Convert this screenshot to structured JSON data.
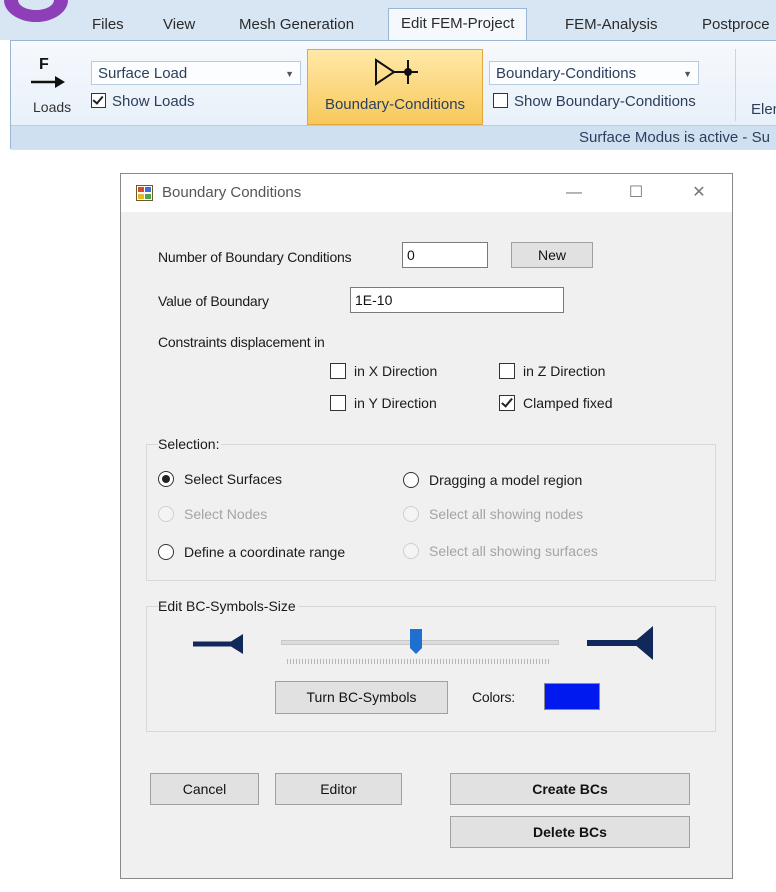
{
  "ribbon": {
    "tabs": [
      "Files",
      "View",
      "Mesh Generation",
      "Edit FEM-Project",
      "FEM-Analysis",
      "Postproce"
    ],
    "active_tab": "Edit FEM-Project",
    "loads_icon_letter": "F",
    "loads_label": "Loads",
    "load_type_combo": "Surface Load",
    "show_loads_label": "Show Loads",
    "show_loads_checked": true,
    "bc_button_label": "Boundary-Conditions",
    "bc_combo": "Boundary-Conditions",
    "show_bc_label": "Show Boundary-Conditions",
    "show_bc_checked": false,
    "element_label_partial": "Elen",
    "status_text": "Surface Modus is active - Su"
  },
  "dialog": {
    "title": "Boundary Conditions",
    "num_bc_label": "Number of Boundary Conditions",
    "num_bc_value": "0",
    "new_button": "New",
    "value_label": "Value of Boundary",
    "value_value": "1E-10",
    "constraints_label": "Constraints displacement in",
    "checks": {
      "x_dir": {
        "label": "in X Direction",
        "checked": false
      },
      "z_dir": {
        "label": "in Z Direction",
        "checked": false
      },
      "y_dir": {
        "label": "in Y Direction",
        "checked": false
      },
      "clamped": {
        "label": "Clamped fixed",
        "checked": true
      }
    },
    "selection": {
      "label": "Selection:",
      "options": {
        "surfaces": {
          "label": "Select Surfaces",
          "selected": true,
          "enabled": true
        },
        "dragging": {
          "label": "Dragging a model region",
          "selected": false,
          "enabled": true
        },
        "nodes": {
          "label": "Select Nodes",
          "selected": false,
          "enabled": false
        },
        "all_nodes": {
          "label": "Select all showing nodes",
          "selected": false,
          "enabled": false
        },
        "coord_range": {
          "label": "Define a coordinate range",
          "selected": false,
          "enabled": true
        },
        "all_surfaces": {
          "label": "Select all showing surfaces",
          "selected": false,
          "enabled": false
        }
      }
    },
    "symbols": {
      "label": "Edit BC-Symbols-Size",
      "slider_value_fraction": 0.49,
      "turn_button": "Turn BC-Symbols",
      "colors_label": "Colors:",
      "color": "#0019ee"
    },
    "buttons": {
      "cancel": "Cancel",
      "editor": "Editor",
      "create": "Create BCs",
      "delete": "Delete BCs"
    }
  }
}
